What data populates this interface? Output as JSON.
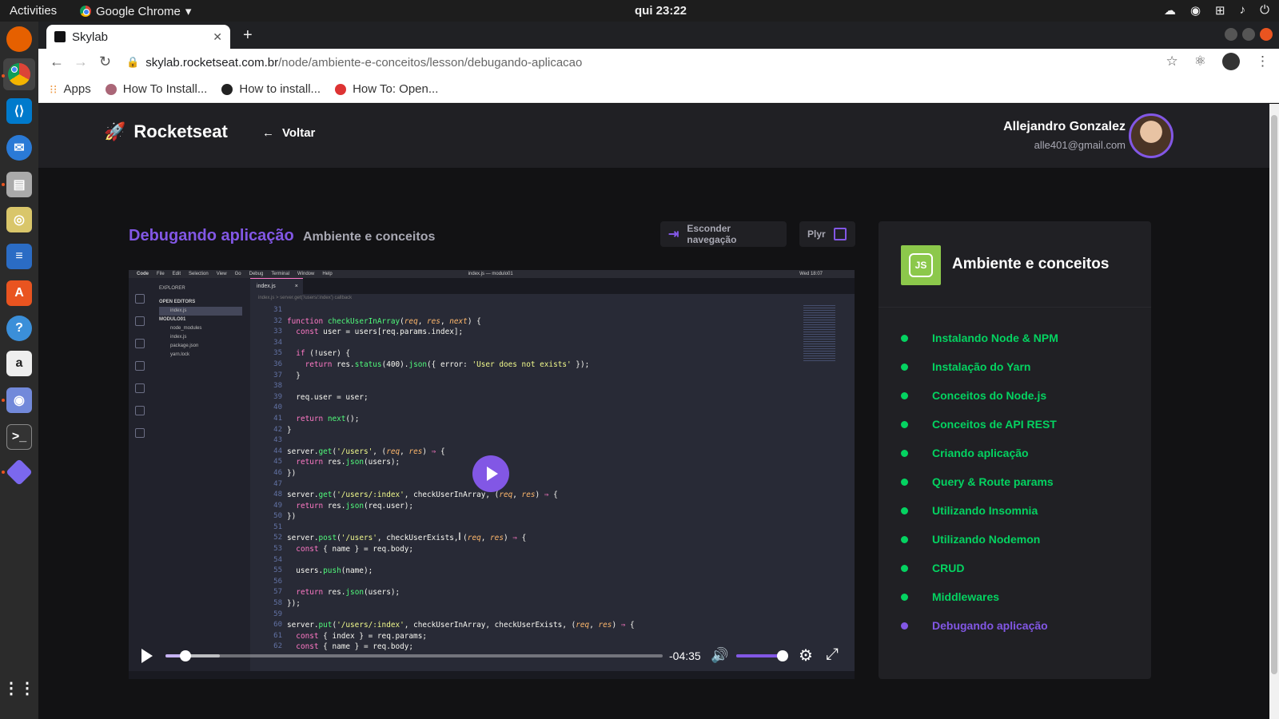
{
  "os": {
    "activities": "Activities",
    "app_name": "Google Chrome",
    "clock": "qui 23:22"
  },
  "browser": {
    "tab_title": "Skylab",
    "url_domain": "skylab.rocketseat.com.br",
    "url_path": "/node/ambiente-e-conceitos/lesson/debugando-aplicacao",
    "bookmarks": [
      "Apps",
      "How To Install...",
      "How to install...",
      "How To: Open..."
    ]
  },
  "header": {
    "brand": "Rocketseat",
    "back_label": "Voltar",
    "user_name": "Allejandro Gonzalez",
    "user_email": "alle401@gmail.com"
  },
  "lesson": {
    "title": "Debugando aplicação",
    "module": "Ambiente e conceitos",
    "hide_nav_label": "Esconder navegação",
    "player_label": "Plyr"
  },
  "player": {
    "time_remaining": "-04:35",
    "progress": 0.04,
    "buffered": 0.11,
    "volume": 0.9
  },
  "video_frame": {
    "menu": [
      "Code",
      "File",
      "Edit",
      "Selection",
      "View",
      "Go",
      "Debug",
      "Terminal",
      "Window",
      "Help"
    ],
    "window_title": "index.js — modulo01",
    "mac_clock": "Wed 18:07",
    "explorer_title": "EXPLORER",
    "open_editors": "OPEN EDITORS",
    "open_file": "index.js",
    "folder": "MODULO01",
    "files": [
      "node_modules",
      "index.js",
      "package.json",
      "yarn.lock"
    ],
    "tab": "index.js",
    "breadcrumb": "index.js > server.get('/users/:index') callback",
    "line_numbers": [
      "31",
      "32",
      "33",
      "34",
      "35",
      "36",
      "37",
      "38",
      "39",
      "40",
      "41",
      "42",
      "43",
      "44",
      "45",
      "46",
      "47",
      "48",
      "49",
      "50",
      "51",
      "52",
      "53",
      "54",
      "55",
      "56",
      "57",
      "58",
      "59",
      "60",
      "61",
      "62"
    ]
  },
  "sidebar": {
    "module_title": "Ambiente e conceitos",
    "badge_text": "JS",
    "lessons": [
      {
        "label": "Instalando Node & NPM",
        "active": false
      },
      {
        "label": "Instalação do Yarn",
        "active": false
      },
      {
        "label": "Conceitos do Node.js",
        "active": false
      },
      {
        "label": "Conceitos de API REST",
        "active": false
      },
      {
        "label": "Criando aplicação",
        "active": false
      },
      {
        "label": "Query & Route params",
        "active": false
      },
      {
        "label": "Utilizando Insomnia",
        "active": false
      },
      {
        "label": "Utilizando Nodemon",
        "active": false
      },
      {
        "label": "CRUD",
        "active": false
      },
      {
        "label": "Middlewares",
        "active": false
      },
      {
        "label": "Debugando aplicação",
        "active": true
      }
    ]
  },
  "colors": {
    "accent": "#8257e5",
    "done": "#04d361",
    "bg": "#121214"
  }
}
